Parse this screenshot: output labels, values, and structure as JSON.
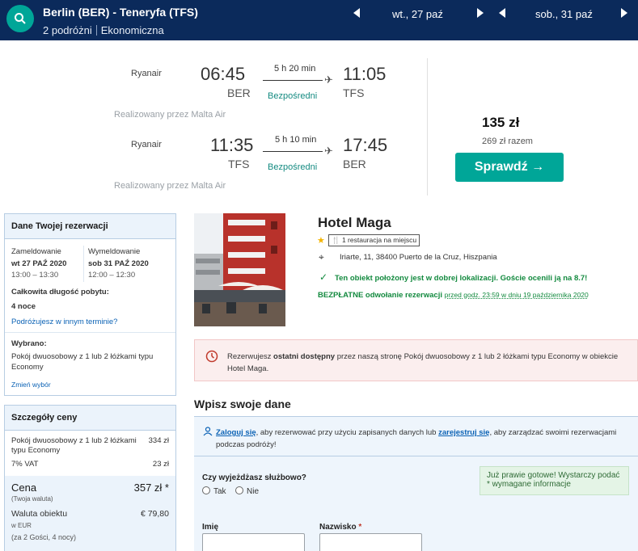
{
  "topbar": {
    "route": "Berlin (BER) - Teneryfa (TFS)",
    "travellers": "2 podróżni",
    "cabin": "Ekonomiczna",
    "date_out": "wt., 27 paź",
    "date_back": "sob., 31 paź"
  },
  "flights": {
    "outbound": {
      "airline": "Ryanair",
      "depart_time": "06:45",
      "depart_code": "BER",
      "duration": "5 h 20 min",
      "stops": "Bezpośredni",
      "arrive_time": "11:05",
      "arrive_code": "TFS",
      "operated": "Realizowany przez Malta Air"
    },
    "inbound": {
      "airline": "Ryanair",
      "depart_time": "11:35",
      "depart_code": "TFS",
      "duration": "5 h 10 min",
      "stops": "Bezpośredni",
      "arrive_time": "17:45",
      "arrive_code": "BER",
      "operated": "Realizowany przez Malta Air"
    },
    "price": "135 zł",
    "price_total": "269 zł razem",
    "check_button": "Sprawdź →"
  },
  "booking": {
    "title": "Dane Twojej rezerwacji",
    "checkin_label": "Zameldowanie",
    "checkin_date": "wt 27 PAŹ 2020",
    "checkin_time": "13:00 – 13:30",
    "checkout_label": "Wymeldowanie",
    "checkout_date": "sob 31 PAŹ 2020",
    "checkout_time": "12:00 – 12:30",
    "length_label": "Całkowita długość pobytu:",
    "length_value": "4 noce",
    "change_dates": "Podróżujesz w innym terminie?",
    "selected_label": "Wybrano:",
    "selected_room": "Pokój dwuosobowy z 1 lub 2 łóżkami typu Economy",
    "change_selection": "Zmień wybór"
  },
  "price_details": {
    "title": "Szczegóły ceny",
    "room_label": "Pokój dwuosobowy z 1 lub 2 łóżkami typu Economy",
    "room_price": "334 zł",
    "vat_label": "7% VAT",
    "vat_price": "23 zł",
    "total_label": "Cena",
    "total_value": "357 zł *",
    "currency_note": "(Twoja waluta)",
    "hotel_currency_label": "Waluta obiektu",
    "hotel_currency_value": "€ 79,80",
    "hotel_currency_sub": "w EUR",
    "guests_note": "(za 2 Gości, 4 nocy)"
  },
  "hotel": {
    "name": "Hotel Maga",
    "restaurant": "1 restauracja na miejscu",
    "address": "Iriarte, 11, 38400 Puerto de la Cruz, Hiszpania",
    "location_note": "Ten obiekt położony jest w dobrej lokalizacji. Goście ocenili ją na 8.7!",
    "free_cancel": "BEZPŁATNE odwołanie rezerwacji",
    "free_cancel_until": "przed godz. 23:59 w dniu 19 października 2020"
  },
  "alert": {
    "prefix": "Rezerwujesz",
    "bold": "ostatni dostępny",
    "text": "przez naszą stronę Pokój dwuosobowy z 1 lub 2 łóżkami typu Economy w obiekcie Hotel Maga."
  },
  "form": {
    "title": "Wpisz swoje dane",
    "login": "Zaloguj się",
    "login_mid": ", aby rezerwować przy użyciu zapisanych danych lub",
    "register": "zarejestruj się",
    "login_end": ", aby zarządzać swoimi rezerwacjami podczas podróży!",
    "business_q": "Czy wyjeżdżasz służbowo?",
    "yes": "Tak",
    "no": "Nie",
    "tip": "Już prawie gotowe! Wystarczy podać * wymagane informacje",
    "first_name": "Imię",
    "last_name": "Nazwisko",
    "required_mark": "*"
  }
}
